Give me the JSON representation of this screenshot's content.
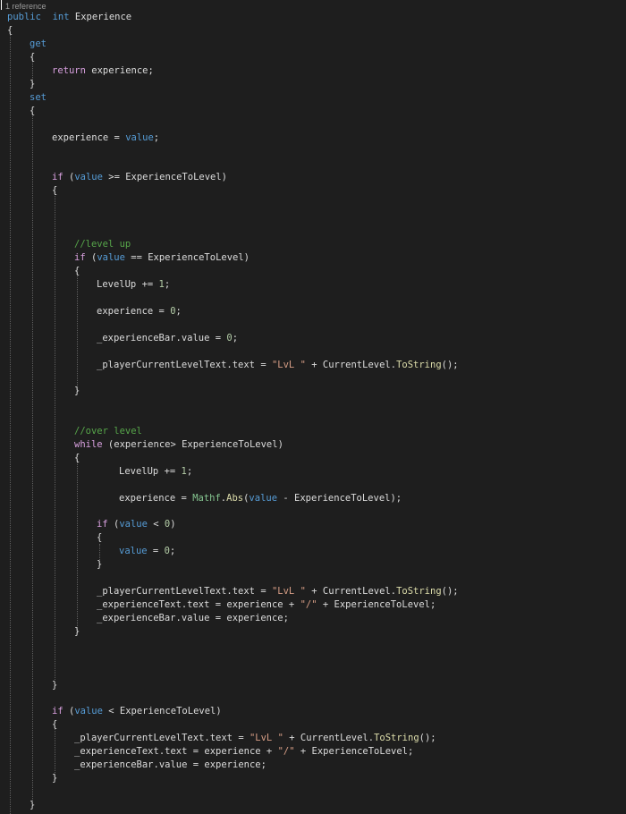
{
  "editor": {
    "codelens": "1 reference",
    "lines": [
      {
        "tokens": [
          {
            "t": "public",
            "c": "kw"
          },
          {
            "t": "  ",
            "c": "txt"
          },
          {
            "t": "int",
            "c": "kw"
          },
          {
            "t": " Experience",
            "c": "txt"
          }
        ]
      },
      {
        "tokens": [
          {
            "t": "{",
            "c": "txt"
          }
        ]
      },
      {
        "tokens": [
          {
            "t": "get",
            "c": "kw"
          }
        ]
      },
      {
        "tokens": [
          {
            "t": "{",
            "c": "txt"
          }
        ]
      },
      {
        "tokens": [
          {
            "t": "return",
            "c": "ctl"
          },
          {
            "t": " experience;",
            "c": "txt"
          }
        ]
      },
      {
        "tokens": [
          {
            "t": "}",
            "c": "txt"
          }
        ]
      },
      {
        "tokens": [
          {
            "t": "set",
            "c": "kw"
          }
        ]
      },
      {
        "tokens": [
          {
            "t": "{",
            "c": "txt"
          }
        ]
      },
      {
        "tokens": [
          {
            "t": "experience = ",
            "c": "txt"
          },
          {
            "t": "value",
            "c": "kw"
          },
          {
            "t": ";",
            "c": "txt"
          }
        ]
      },
      {
        "tokens": [
          {
            "t": "if",
            "c": "ctl"
          },
          {
            "t": " (",
            "c": "txt"
          },
          {
            "t": "value",
            "c": "kw"
          },
          {
            "t": " >= ExperienceToLevel)",
            "c": "txt"
          }
        ]
      },
      {
        "tokens": [
          {
            "t": "{",
            "c": "txt"
          }
        ]
      },
      {
        "tokens": [
          {
            "t": "//level up",
            "c": "cmt"
          }
        ]
      },
      {
        "tokens": [
          {
            "t": "if",
            "c": "ctl"
          },
          {
            "t": " (",
            "c": "txt"
          },
          {
            "t": "value",
            "c": "kw"
          },
          {
            "t": " == ExperienceToLevel)",
            "c": "txt"
          }
        ]
      },
      {
        "tokens": [
          {
            "t": "{",
            "c": "txt"
          }
        ]
      },
      {
        "tokens": [
          {
            "t": "LevelUp += ",
            "c": "txt"
          },
          {
            "t": "1",
            "c": "num"
          },
          {
            "t": ";",
            "c": "txt"
          }
        ]
      },
      {
        "tokens": [
          {
            "t": "experience = ",
            "c": "txt"
          },
          {
            "t": "0",
            "c": "num"
          },
          {
            "t": ";",
            "c": "txt"
          }
        ]
      },
      {
        "tokens": [
          {
            "t": "_experienceBar.value = ",
            "c": "txt"
          },
          {
            "t": "0",
            "c": "num"
          },
          {
            "t": ";",
            "c": "txt"
          }
        ]
      },
      {
        "tokens": [
          {
            "t": "_playerCurrentLevelText.text = ",
            "c": "txt"
          },
          {
            "t": "\"LvL \"",
            "c": "str"
          },
          {
            "t": " + CurrentLevel.",
            "c": "txt"
          },
          {
            "t": "ToString",
            "c": "mth"
          },
          {
            "t": "();",
            "c": "txt"
          }
        ]
      },
      {
        "tokens": [
          {
            "t": "}",
            "c": "txt"
          }
        ]
      },
      {
        "tokens": [
          {
            "t": "//over level",
            "c": "cmt"
          }
        ]
      },
      {
        "tokens": [
          {
            "t": "while",
            "c": "ctl"
          },
          {
            "t": " (experience> ExperienceToLevel)",
            "c": "txt"
          }
        ]
      },
      {
        "tokens": [
          {
            "t": "{",
            "c": "txt"
          }
        ]
      },
      {
        "tokens": [
          {
            "t": "LevelUp += ",
            "c": "txt"
          },
          {
            "t": "1",
            "c": "num"
          },
          {
            "t": ";",
            "c": "txt"
          }
        ]
      },
      {
        "tokens": [
          {
            "t": "experience = ",
            "c": "txt"
          },
          {
            "t": "Mathf",
            "c": "typ"
          },
          {
            "t": ".",
            "c": "txt"
          },
          {
            "t": "Abs",
            "c": "mth"
          },
          {
            "t": "(",
            "c": "txt"
          },
          {
            "t": "value",
            "c": "kw"
          },
          {
            "t": " - ExperienceToLevel);",
            "c": "txt"
          }
        ]
      },
      {
        "tokens": [
          {
            "t": "if",
            "c": "ctl"
          },
          {
            "t": " (",
            "c": "txt"
          },
          {
            "t": "value",
            "c": "kw"
          },
          {
            "t": " < ",
            "c": "txt"
          },
          {
            "t": "0",
            "c": "num"
          },
          {
            "t": ")",
            "c": "txt"
          }
        ]
      },
      {
        "tokens": [
          {
            "t": "{",
            "c": "txt"
          }
        ]
      },
      {
        "tokens": [
          {
            "t": "value",
            "c": "kw"
          },
          {
            "t": " = ",
            "c": "txt"
          },
          {
            "t": "0",
            "c": "num"
          },
          {
            "t": ";",
            "c": "txt"
          }
        ]
      },
      {
        "tokens": [
          {
            "t": "}",
            "c": "txt"
          }
        ]
      },
      {
        "tokens": [
          {
            "t": "_playerCurrentLevelText.text = ",
            "c": "txt"
          },
          {
            "t": "\"LvL \"",
            "c": "str"
          },
          {
            "t": " + CurrentLevel.",
            "c": "txt"
          },
          {
            "t": "ToString",
            "c": "mth"
          },
          {
            "t": "();",
            "c": "txt"
          }
        ]
      },
      {
        "tokens": [
          {
            "t": "_experienceText.text = experience + ",
            "c": "txt"
          },
          {
            "t": "\"/\"",
            "c": "str"
          },
          {
            "t": " + ExperienceToLevel;",
            "c": "txt"
          }
        ]
      },
      {
        "tokens": [
          {
            "t": "_experienceBar.value = experience;",
            "c": "txt"
          }
        ]
      },
      {
        "tokens": [
          {
            "t": "}",
            "c": "txt"
          }
        ]
      },
      {
        "tokens": [
          {
            "t": "}",
            "c": "txt"
          }
        ]
      },
      {
        "tokens": [
          {
            "t": "if",
            "c": "ctl"
          },
          {
            "t": " (",
            "c": "txt"
          },
          {
            "t": "value",
            "c": "kw"
          },
          {
            "t": " < ExperienceToLevel)",
            "c": "txt"
          }
        ]
      },
      {
        "tokens": [
          {
            "t": "{",
            "c": "txt"
          }
        ]
      },
      {
        "tokens": [
          {
            "t": "_playerCurrentLevelText.text = ",
            "c": "txt"
          },
          {
            "t": "\"LvL \"",
            "c": "str"
          },
          {
            "t": " + CurrentLevel.",
            "c": "txt"
          },
          {
            "t": "ToString",
            "c": "mth"
          },
          {
            "t": "();",
            "c": "txt"
          }
        ]
      },
      {
        "tokens": [
          {
            "t": "_experienceText.text = experience + ",
            "c": "txt"
          },
          {
            "t": "\"/\"",
            "c": "str"
          },
          {
            "t": " + ExperienceToLevel;",
            "c": "txt"
          }
        ]
      },
      {
        "tokens": [
          {
            "t": "_experienceBar.value = experience;",
            "c": "txt"
          }
        ]
      },
      {
        "tokens": [
          {
            "t": "}",
            "c": "txt"
          }
        ]
      },
      {
        "tokens": [
          {
            "t": "}",
            "c": "txt"
          }
        ]
      }
    ]
  },
  "theme": {
    "background": "#1e1e1e",
    "text": "#dcdcdc",
    "keyword": "#569cd6",
    "control": "#d8a0df",
    "number": "#b5cea8",
    "string": "#d69d85",
    "comment": "#57a64a",
    "type": "#86c691",
    "method": "#dcdcaa"
  }
}
